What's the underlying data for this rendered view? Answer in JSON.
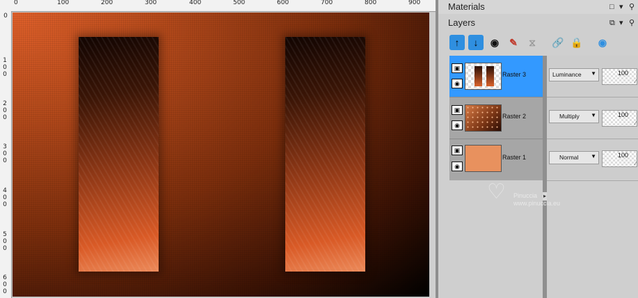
{
  "ruler": {
    "top_labels": [
      "0",
      "100",
      "200",
      "300",
      "400",
      "500",
      "600",
      "700",
      "800",
      "900"
    ],
    "left_labels": [
      "0",
      "100",
      "200",
      "300",
      "400",
      "500",
      "600"
    ]
  },
  "materials": {
    "title": "Materials"
  },
  "layers": {
    "title": "Layers",
    "toolbar": [
      "promote-layer-icon",
      "demote-layer-icon",
      "visibility-icon",
      "edit-selection-icon",
      "link-mask-icon",
      "link-icon",
      "lock-icon",
      "layer-properties-icon"
    ],
    "items": [
      {
        "name": "Raster 3",
        "blend_mode": "Luminance",
        "opacity": "100",
        "selected": true
      },
      {
        "name": "Raster 2",
        "blend_mode": "Multiply",
        "opacity": "100",
        "selected": false
      },
      {
        "name": "Raster 1",
        "blend_mode": "Normal",
        "opacity": "100",
        "selected": false
      }
    ]
  },
  "watermark": {
    "line1": "Pinuccia",
    "line2": "www.pinuccia.eu"
  },
  "colors": {
    "selection": "#3399ff",
    "canvas_orange": "#d95a26",
    "raster1_thumb": "#e8915e"
  }
}
